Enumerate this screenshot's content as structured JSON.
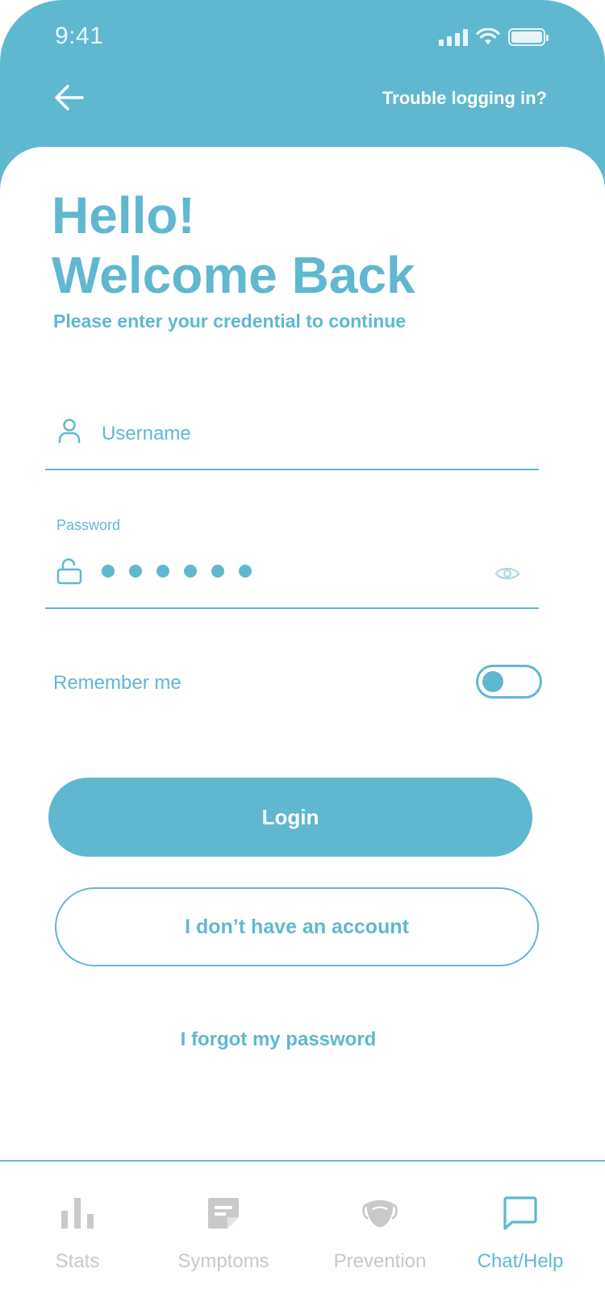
{
  "status_bar": {
    "time": "9:41"
  },
  "header": {
    "trouble_label": "Trouble logging in?"
  },
  "greeting": {
    "line1": "Hello!",
    "line2": "Welcome Back",
    "subtitle": "Please enter your credential to continue"
  },
  "form": {
    "username_placeholder": "Username",
    "password_label": "Password",
    "password_masked_length": 6,
    "remember_label": "Remember me",
    "remember_on": false
  },
  "actions": {
    "login_label": "Login",
    "no_account_label": "I don’t have an account",
    "forgot_label": "I forgot my password"
  },
  "tabbar": {
    "tabs": [
      {
        "label": "Stats",
        "icon": "bar-chart-icon",
        "active": false
      },
      {
        "label": "Symptoms",
        "icon": "note-icon",
        "active": false
      },
      {
        "label": "Prevention",
        "icon": "face-mask-icon",
        "active": false
      },
      {
        "label": "Chat/Help",
        "icon": "chat-bubble-icon",
        "active": true
      }
    ]
  },
  "colors": {
    "primary": "#5fb8cf",
    "inactive": "#c9c9c9",
    "background": "#ffffff"
  }
}
